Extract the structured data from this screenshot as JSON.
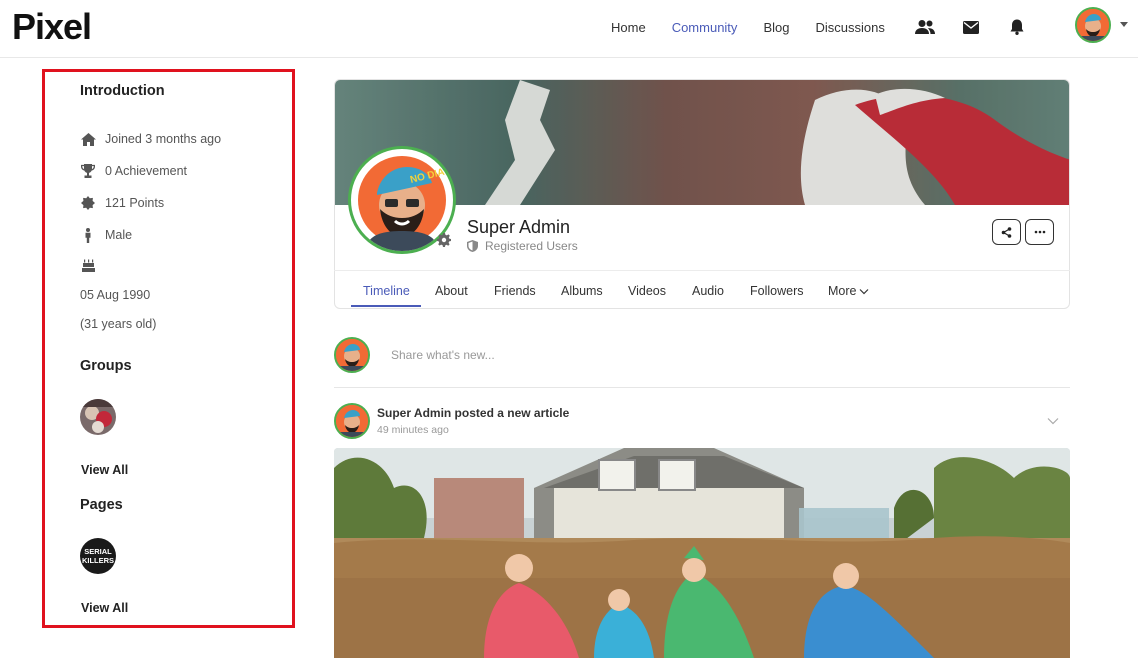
{
  "app": {
    "logo": "Pixel"
  },
  "nav": {
    "items": [
      {
        "label": "Home",
        "active": false
      },
      {
        "label": "Community",
        "active": true
      },
      {
        "label": "Blog",
        "active": false
      },
      {
        "label": "Discussions",
        "active": false
      }
    ],
    "icons": [
      "users-icon",
      "envelope-icon",
      "bell-icon"
    ]
  },
  "sidebar": {
    "introduction": {
      "title": "Introduction",
      "joined": "Joined 3 months ago",
      "achievement": "0 Achievement",
      "points": "121 Points",
      "gender": "Male",
      "birthday": "05 Aug 1990",
      "age": "(31 years old)"
    },
    "groups": {
      "title": "Groups",
      "view_all": "View All"
    },
    "pages": {
      "title": "Pages",
      "view_all": "View All",
      "thumb_text": "SERIAL KILLERS"
    }
  },
  "profile": {
    "name": "Super Admin",
    "role": "Registered Users",
    "tabs": [
      {
        "label": "Timeline",
        "active": true
      },
      {
        "label": "About"
      },
      {
        "label": "Friends"
      },
      {
        "label": "Albums"
      },
      {
        "label": "Videos"
      },
      {
        "label": "Audio"
      },
      {
        "label": "Followers"
      },
      {
        "label": "More"
      }
    ]
  },
  "composer": {
    "placeholder": "Share what's new..."
  },
  "post": {
    "title": "Super Admin posted a new article",
    "time": "49 minutes ago"
  },
  "colors": {
    "accent": "#4a5bb8",
    "highlight_border": "#e0121e",
    "avatar_ring": "#4caf50"
  }
}
